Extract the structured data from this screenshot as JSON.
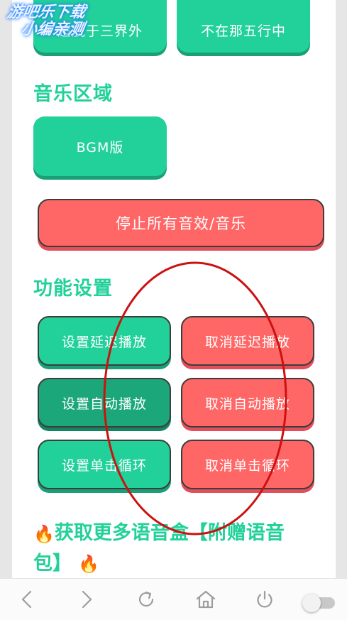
{
  "top_buttons": [
    {
      "label": "超脱于三界外"
    },
    {
      "label": "不在那五行中"
    }
  ],
  "music_section": {
    "title": "音乐区域",
    "bgm_label": "BGM版",
    "stop_all_label": "停止所有音效/音乐"
  },
  "settings_section": {
    "title": "功能设置",
    "buttons": [
      {
        "label": "设置延迟播放"
      },
      {
        "label": "取消延迟播放"
      },
      {
        "label": "设置自动播放"
      },
      {
        "label": "取消自动播放"
      },
      {
        "label": "设置单击循环"
      },
      {
        "label": "取消单击循环"
      }
    ]
  },
  "more": {
    "text": "获取更多语音盒【附赠语音包】",
    "fire_icon": "🔥"
  },
  "watermark": {
    "line1": "游吧乐下载",
    "line2": "小编亲测"
  },
  "bottom_nav": {
    "icons": [
      "back-icon",
      "forward-icon",
      "refresh-icon",
      "home-icon",
      "power-icon"
    ]
  },
  "colors": {
    "accent_green": "#22d199",
    "accent_red": "#ff6767",
    "annotation_red": "#cc1111"
  }
}
